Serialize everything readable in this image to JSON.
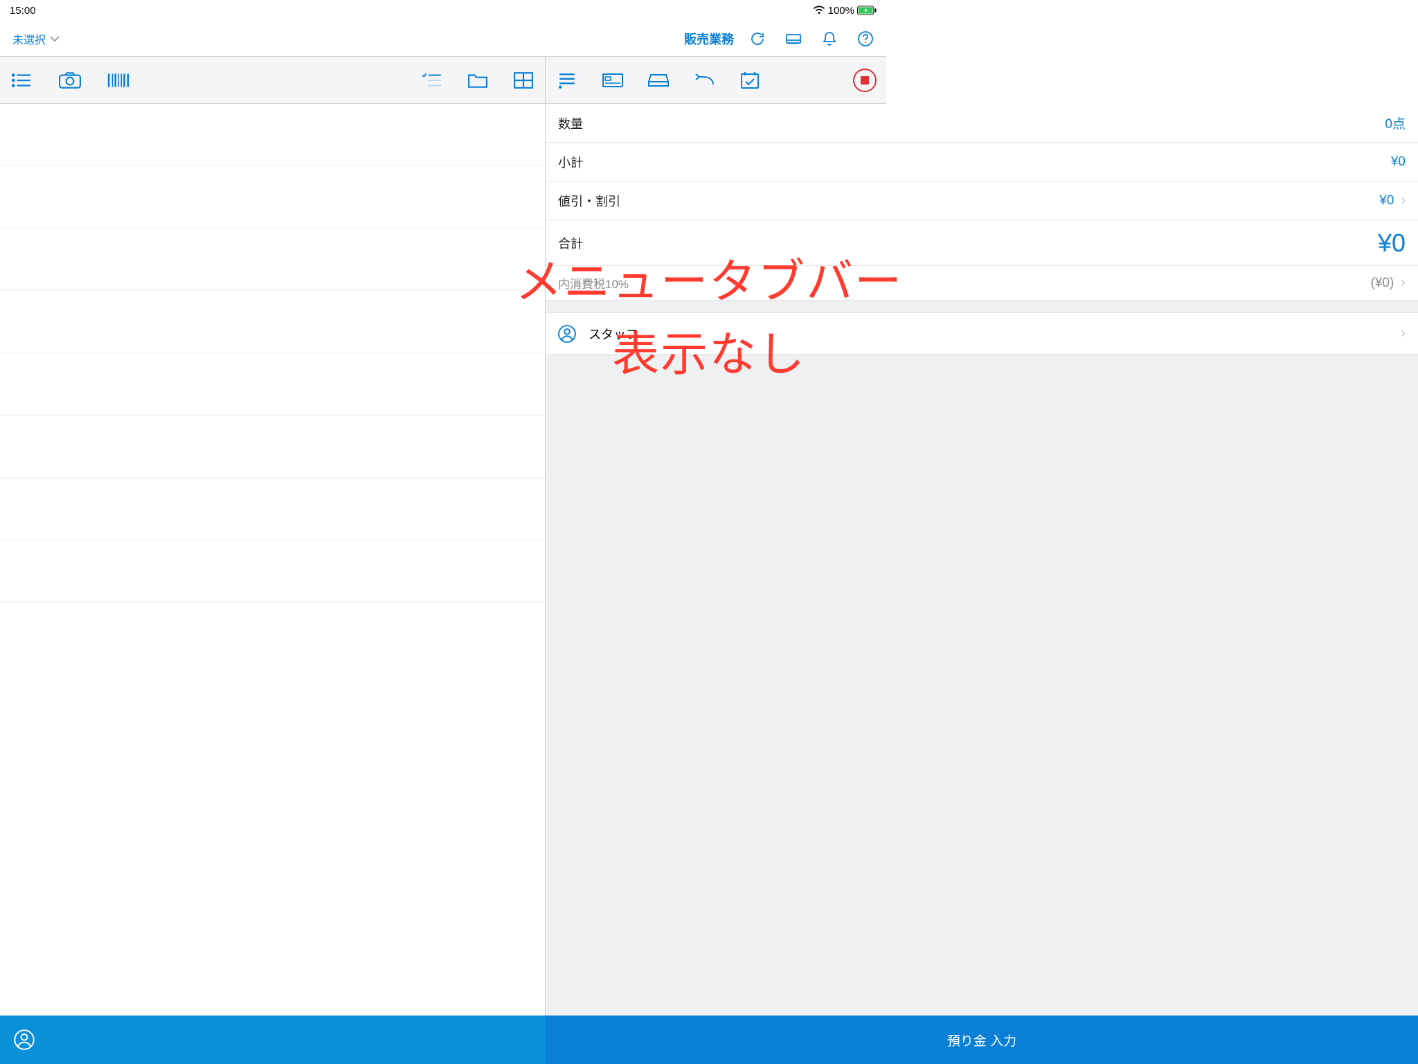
{
  "status": {
    "time": "15:00",
    "battery": "100%"
  },
  "nav": {
    "selector_label": "未選択",
    "title": "販売業務"
  },
  "summary": {
    "qty_label": "数量",
    "qty_value": "0点",
    "subtotal_label": "小計",
    "subtotal_value": "¥0",
    "discount_label": "値引・割引",
    "discount_value": "¥0",
    "total_label": "合計",
    "total_value": "¥0",
    "tax_label": "内消費税10%",
    "tax_value": "(¥0)",
    "staff_label": "スタッフ"
  },
  "bottom": {
    "deposit_label": "預り金 入力"
  },
  "annotation": {
    "line1": "メニュータブバー",
    "line2": "表示なし"
  }
}
